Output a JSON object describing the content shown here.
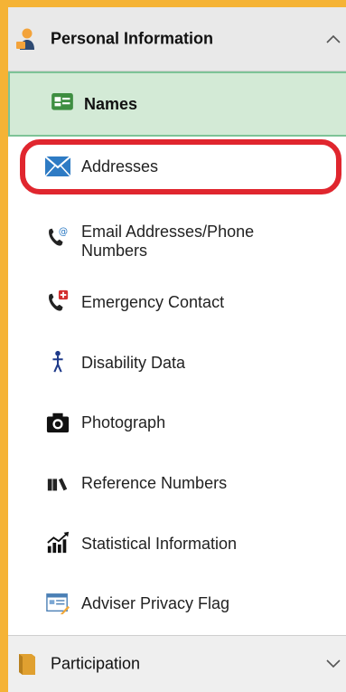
{
  "sections": {
    "personal": {
      "label": "Personal Information",
      "icon": "person-info-icon",
      "expanded": true
    },
    "participation": {
      "label": "Participation",
      "icon": "book-icon",
      "expanded": false
    }
  },
  "items": [
    {
      "label": "Names",
      "icon": "id-card-icon",
      "selected": true
    },
    {
      "label": "Addresses",
      "icon": "envelope-icon",
      "highlighted": true
    },
    {
      "label": "Email Addresses/Phone Numbers",
      "icon": "phone-email-icon"
    },
    {
      "label": "Emergency Contact",
      "icon": "phone-emergency-icon"
    },
    {
      "label": "Disability Data",
      "icon": "person-figure-icon"
    },
    {
      "label": "Photograph",
      "icon": "camera-icon"
    },
    {
      "label": "Reference Numbers",
      "icon": "books-icon"
    },
    {
      "label": "Statistical Information",
      "icon": "chart-icon"
    },
    {
      "label": "Adviser Privacy Flag",
      "icon": "form-icon"
    }
  ],
  "colors": {
    "background": "#F5B335",
    "selected_bg": "#D3EAD6",
    "highlight_ring": "#E0262E"
  }
}
